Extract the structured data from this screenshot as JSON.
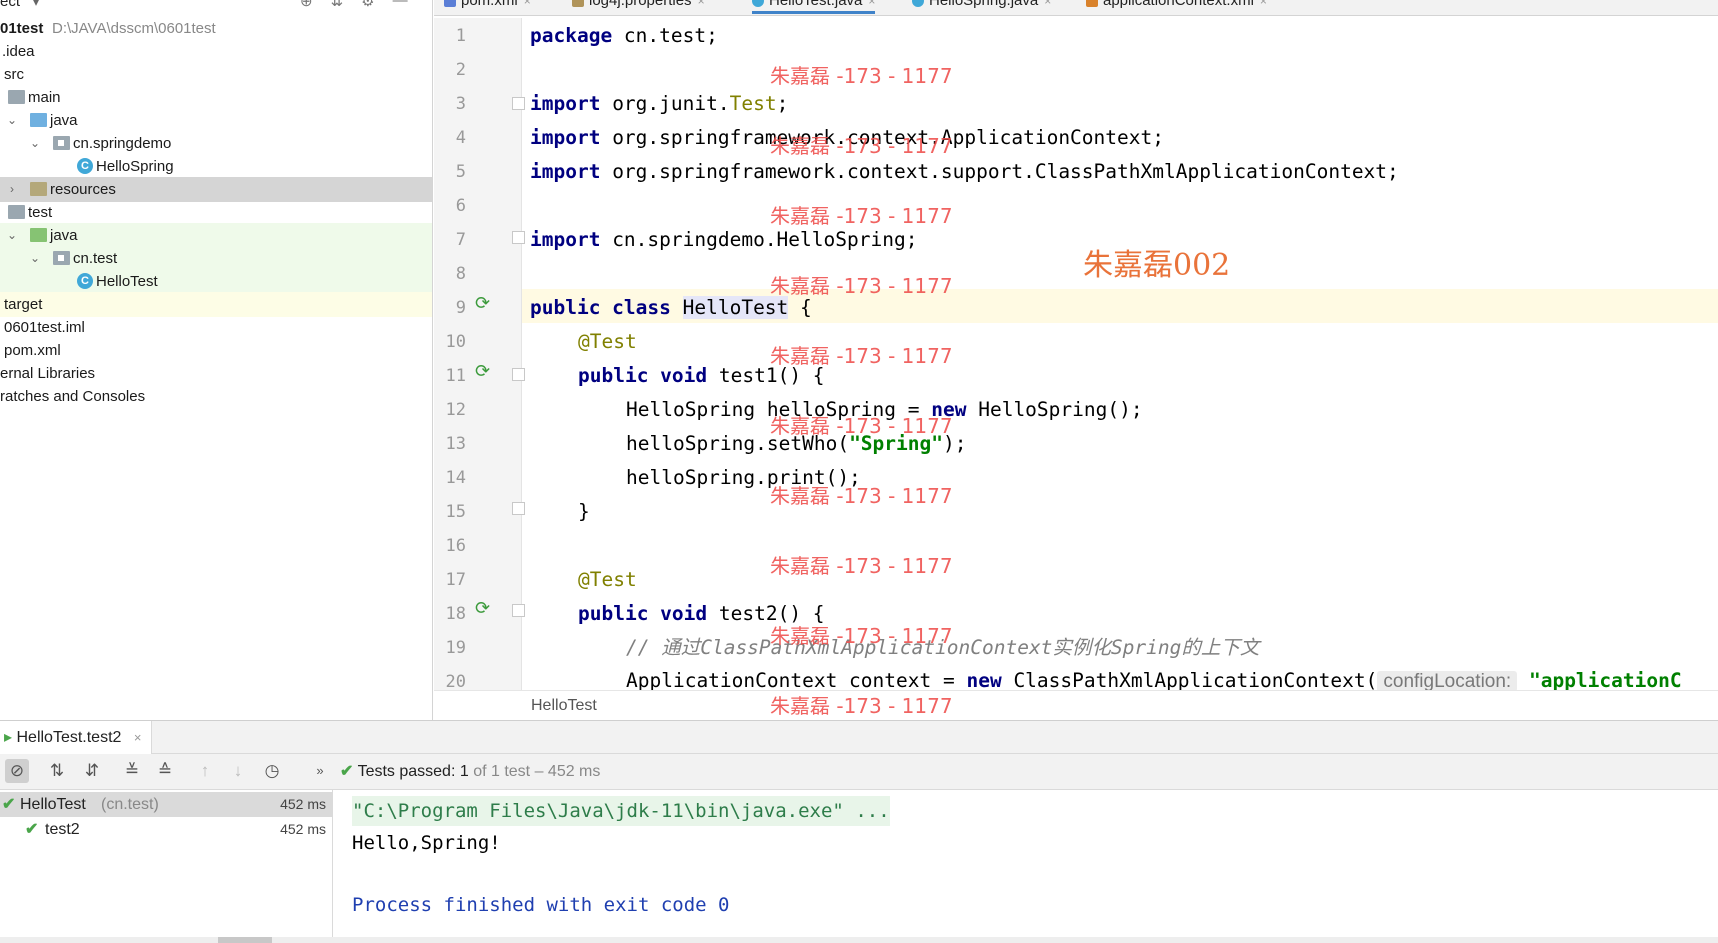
{
  "project": {
    "header_label": "ect",
    "items": [
      {
        "label": "01test",
        "path": "D:\\JAVA\\dsscm\\0601test"
      },
      {
        "label": ".idea"
      },
      {
        "label": "src"
      },
      {
        "label": "main"
      },
      {
        "label": "java"
      },
      {
        "label": "cn.springdemo"
      },
      {
        "label": "HelloSpring"
      },
      {
        "label": "resources"
      },
      {
        "label": "test"
      },
      {
        "label": "java"
      },
      {
        "label": "cn.test"
      },
      {
        "label": "HelloTest"
      },
      {
        "label": "target"
      },
      {
        "label": "0601test.iml"
      },
      {
        "label": "pom.xml"
      },
      {
        "label": "ernal Libraries"
      },
      {
        "label": "ratches and Consoles"
      }
    ]
  },
  "tabs": [
    {
      "label": "pom.xml"
    },
    {
      "label": "log4j.properties"
    },
    {
      "label": "HelloTest.java"
    },
    {
      "label": "HelloSpring.java"
    },
    {
      "label": "applicationContext.xml"
    }
  ],
  "editor": {
    "line_numbers": [
      "1",
      "2",
      "3",
      "4",
      "5",
      "6",
      "7",
      "8",
      "9",
      "10",
      "11",
      "12",
      "13",
      "14",
      "15",
      "16",
      "17",
      "18",
      "19",
      "20"
    ],
    "code": {
      "l1_kw": "package",
      "l1_rest": " cn.test;",
      "l3_kw": "import",
      "l3_rest": " org.junit.",
      "l3_ann": "Test",
      "l3_end": ";",
      "l4_kw": "import",
      "l4_rest": " org.springframework.context.ApplicationContext;",
      "l5_kw": "import",
      "l5_rest": " org.springframework.context.support.ClassPathXmlApplicationContext;",
      "l7_kw": "import",
      "l7_rest": " cn.springdemo.HelloSpring;",
      "l9_kw": "public class ",
      "l9_name": "HelloTest",
      "l9_rest": " {",
      "l10_ann": "@Test",
      "l11_kw": "public void",
      "l11_rest": " test1() {",
      "l12_a": "HelloSpring helloSpring = ",
      "l12_kw": "new",
      "l12_b": " HelloSpring();",
      "l13_a": "helloSpring.setWho(",
      "l13_str": "\"Spring\"",
      "l13_b": ");",
      "l14": "helloSpring.print();",
      "l15": "}",
      "l17_ann": "@Test",
      "l18_kw": "public void",
      "l18_rest": " test2() {",
      "l19_cmt": "// 通过ClassPathXmlApplicationContext实例化Spring的上下文",
      "l20_a": "ApplicationContext context = ",
      "l20_kw": "new",
      "l20_b": " ClassPathXmlApplicationContext(",
      "l20_hint": "configLocation:",
      "l20_str": "\"applicationC"
    },
    "breadcrumb": "HelloTest"
  },
  "watermarks": {
    "repeat": "朱嘉磊 -173 - 1177",
    "large": "朱嘉磊002"
  },
  "run": {
    "tab_label": "HelloTest.test2",
    "status_prefix": "Tests passed:",
    "status_count": "1",
    "status_rest": "of 1 test – 452 ms",
    "tree": [
      {
        "label": "HelloTest",
        "pkg": "(cn.test)",
        "time": "452 ms"
      },
      {
        "label": "test2",
        "time": "452 ms"
      }
    ],
    "console": {
      "command": "\"C:\\Program Files\\Java\\jdk-11\\bin\\java.exe\" ...",
      "output": "Hello,Spring!",
      "exit": "Process finished with exit code 0"
    }
  },
  "colors": {
    "keyword": "#000080",
    "annotation": "#808000",
    "string": "#008000",
    "watermark": "#ef5350",
    "pass": "#4aa54a"
  }
}
